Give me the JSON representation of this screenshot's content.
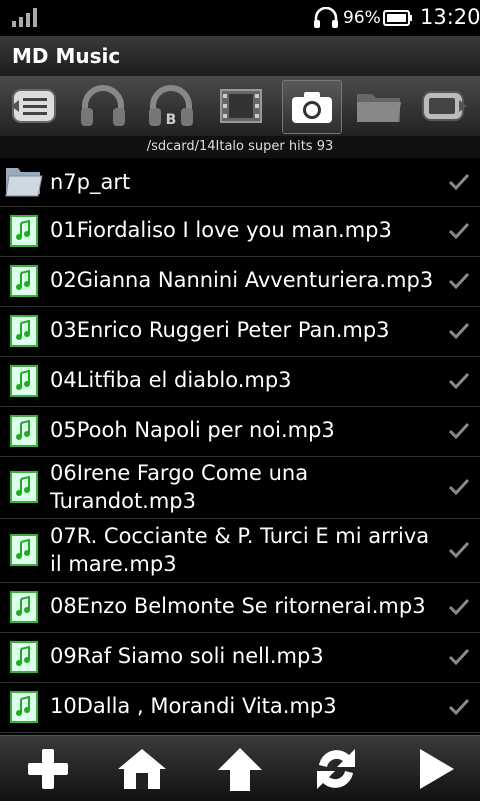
{
  "status_bar": {
    "battery_percent": "96%",
    "time": "13:20",
    "icons": [
      "signal-icon",
      "headphones-icon",
      "battery-icon"
    ]
  },
  "app": {
    "title": "MD Music"
  },
  "toolbar": {
    "buttons": [
      {
        "icon": "list-icon"
      },
      {
        "icon": "headphones-icon"
      },
      {
        "icon": "headphones-b-icon",
        "label": "B"
      },
      {
        "icon": "video-icon"
      },
      {
        "icon": "camera-icon",
        "active": true
      },
      {
        "icon": "folder-icon"
      },
      {
        "icon": "exit-icon"
      }
    ]
  },
  "current_path": "/sdcard/14Italo super hits 93",
  "files": [
    {
      "name": "n7p_art",
      "type": "folder"
    },
    {
      "name": "01Fiordaliso I love you man.mp3",
      "type": "audio"
    },
    {
      "name": "02Gianna Nannini Avventuriera.mp3",
      "type": "audio"
    },
    {
      "name": "03Enrico Ruggeri Peter Pan.mp3",
      "type": "audio"
    },
    {
      "name": "04Litfiba el diablo.mp3",
      "type": "audio"
    },
    {
      "name": "05Pooh Napoli per noi.mp3",
      "type": "audio"
    },
    {
      "name": "06Irene Fargo Come una Turandot.mp3",
      "type": "audio"
    },
    {
      "name": "07R. Cocciante & P. Turci E mi arriva il mare.mp3",
      "type": "audio"
    },
    {
      "name": "08Enzo Belmonte Se ritornerai.mp3",
      "type": "audio"
    },
    {
      "name": "09Raf Siamo soli nell.mp3",
      "type": "audio"
    },
    {
      "name": "10Dalla , Morandi Vita.mp3",
      "type": "audio"
    }
  ],
  "bottom_bar": {
    "buttons": [
      {
        "icon": "add-icon"
      },
      {
        "icon": "home-icon"
      },
      {
        "icon": "up-arrow-icon"
      },
      {
        "icon": "shuffle-icon"
      },
      {
        "icon": "play-icon"
      }
    ]
  },
  "colors": {
    "accent_green": "#3fae3f",
    "checkmark": "#8a8a8a",
    "background": "#000000"
  }
}
